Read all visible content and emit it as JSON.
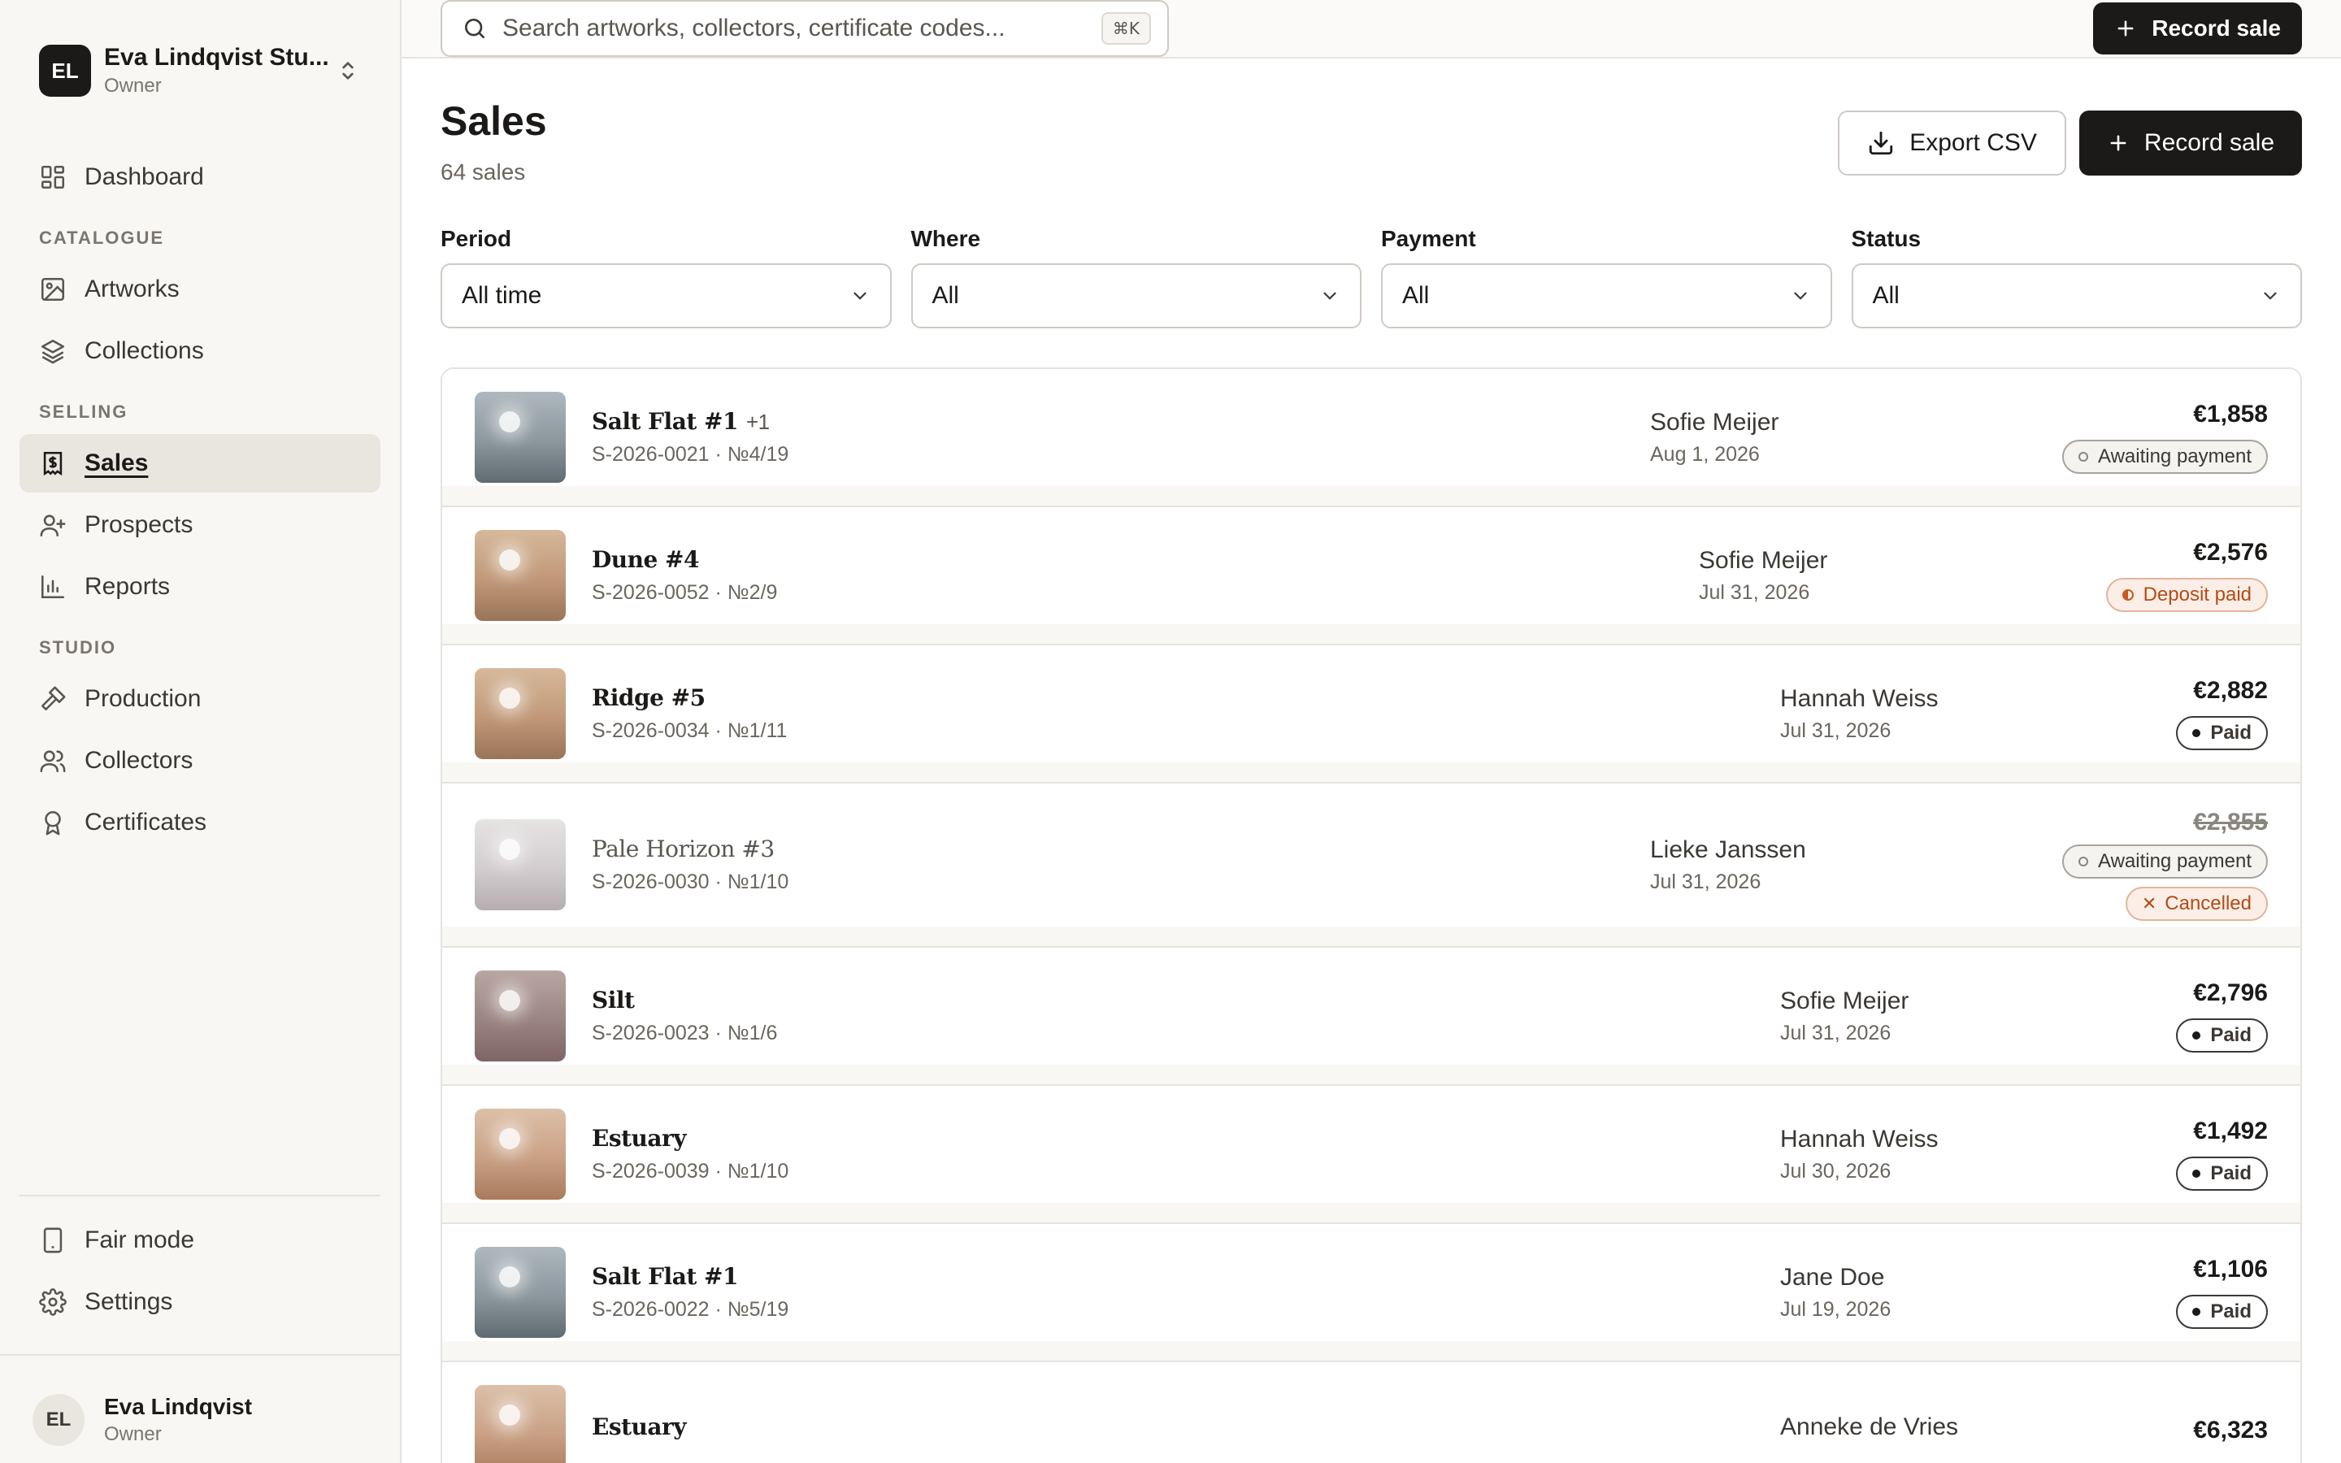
{
  "workspace": {
    "initials": "EL",
    "name": "Eva Lindqvist Stu...",
    "role": "Owner"
  },
  "nav": {
    "dashboard": "Dashboard",
    "catalogue_label": "CATALOGUE",
    "artworks": "Artworks",
    "collections": "Collections",
    "selling_label": "SELLING",
    "sales": "Sales",
    "prospects": "Prospects",
    "reports": "Reports",
    "studio_label": "STUDIO",
    "production": "Production",
    "collectors": "Collectors",
    "certificates": "Certificates",
    "fair_mode": "Fair mode",
    "settings": "Settings"
  },
  "user": {
    "initials": "EL",
    "name": "Eva Lindqvist",
    "role": "Owner"
  },
  "search": {
    "placeholder": "Search artworks, collectors, certificate codes...",
    "shortcut": "⌘K"
  },
  "topbar": {
    "record_sale": "Record sale"
  },
  "page": {
    "title": "Sales",
    "count": "64 sales",
    "export_csv": "Export CSV",
    "record_sale": "Record sale"
  },
  "filters": [
    {
      "label": "Period",
      "value": "All time"
    },
    {
      "label": "Where",
      "value": "All"
    },
    {
      "label": "Payment",
      "value": "All"
    },
    {
      "label": "Status",
      "value": "All"
    }
  ],
  "sales": [
    {
      "title": "Salt Flat #1",
      "extra": "+1",
      "code": "S-2026-0021 · №4/19",
      "buyer": "Sofie Meijer",
      "date": "Aug 1, 2026",
      "price": "€1,858",
      "badges": [
        "Awaiting payment"
      ],
      "thumb": "slate"
    },
    {
      "title": "Dune #4",
      "extra": "",
      "code": "S-2026-0052 · №2/9",
      "buyer": "Sofie Meijer",
      "date": "Jul 31, 2026",
      "price": "€2,576",
      "badges": [
        "Deposit paid"
      ],
      "thumb": "sand"
    },
    {
      "title": "Ridge #5",
      "extra": "",
      "code": "S-2026-0034 · №1/11",
      "buyer": "Hannah Weiss",
      "date": "Jul 31, 2026",
      "price": "€2,882",
      "badges": [
        "Paid"
      ],
      "thumb": "sand"
    },
    {
      "title": "Pale Horizon #3",
      "extra": "",
      "code": "S-2026-0030 · №1/10",
      "buyer": "Lieke Janssen",
      "date": "Jul 31, 2026",
      "price": "€2,855",
      "badges": [
        "Awaiting payment",
        "Cancelled"
      ],
      "thumb": "pale"
    },
    {
      "title": "Silt",
      "extra": "",
      "code": "S-2026-0023 · №1/6",
      "buyer": "Sofie Meijer",
      "date": "Jul 31, 2026",
      "price": "€2,796",
      "badges": [
        "Paid"
      ],
      "thumb": "mauve"
    },
    {
      "title": "Estuary",
      "extra": "",
      "code": "S-2026-0039 · №1/10",
      "buyer": "Hannah Weiss",
      "date": "Jul 30, 2026",
      "price": "€1,492",
      "badges": [
        "Paid"
      ],
      "thumb": "peach"
    },
    {
      "title": "Salt Flat #1",
      "extra": "",
      "code": "S-2026-0022 · №5/19",
      "buyer": "Jane Doe",
      "date": "Jul 19, 2026",
      "price": "€1,106",
      "badges": [
        "Paid"
      ],
      "thumb": "slate"
    },
    {
      "title": "Estuary",
      "extra": "",
      "code": "",
      "buyer": "Anneke de Vries",
      "date": "",
      "price": "€6,323",
      "badges": [],
      "thumb": "peach"
    }
  ]
}
